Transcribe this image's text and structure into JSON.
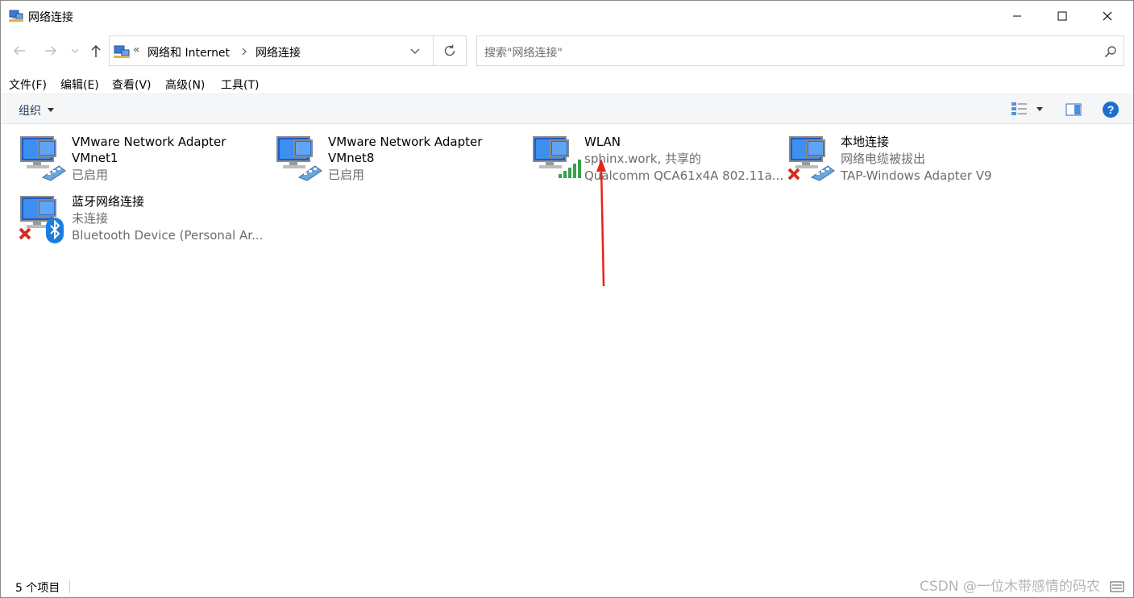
{
  "window": {
    "title": "网络连接"
  },
  "address": {
    "overflow": "«",
    "crumbs": [
      "网络和 Internet",
      "网络连接"
    ]
  },
  "search": {
    "placeholder": "搜索\"网络连接\""
  },
  "menu": [
    "文件(F)",
    "编辑(E)",
    "查看(V)",
    "高级(N)",
    "工具(T)"
  ],
  "toolbar": {
    "organize_label": "组织"
  },
  "connections": [
    {
      "name": "VMware Network Adapter VMnet1",
      "status": "已启用",
      "device": "",
      "icon": "ethernet-adapter-icon"
    },
    {
      "name": "VMware Network Adapter VMnet8",
      "status": "已启用",
      "device": "",
      "icon": "ethernet-adapter-icon"
    },
    {
      "name": "WLAN",
      "status": "sphinx.work, 共享的",
      "device": "Qualcomm QCA61x4A 802.11a...",
      "icon": "wifi-signal-icon"
    },
    {
      "name": "本地连接",
      "status": "网络电缆被拔出",
      "device": "TAP-Windows Adapter V9",
      "icon": "ethernet-disconnected-icon"
    },
    {
      "name": "蓝牙网络连接",
      "status": "未连接",
      "device": "Bluetooth Device (Personal Ar...",
      "icon": "bluetooth-icon"
    }
  ],
  "statusbar": {
    "count": "5 个项目"
  },
  "watermark": "CSDN @一位木带感情的码农",
  "colors": {
    "accent": "#0078d7",
    "annotation_arrow": "#e8231b",
    "error": "#d62c1f",
    "signal": "#3aa04a"
  }
}
